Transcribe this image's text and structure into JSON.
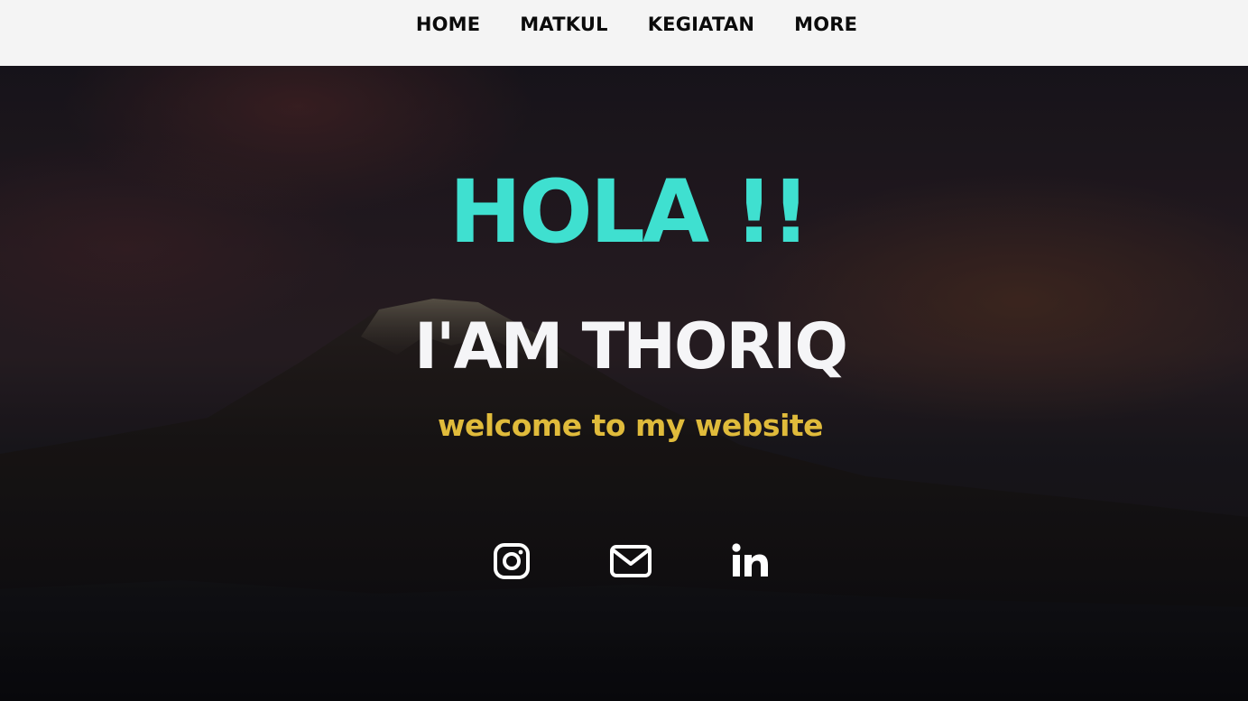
{
  "nav": {
    "items": [
      {
        "label": "HOME"
      },
      {
        "label": "MATKUL"
      },
      {
        "label": "KEGIATAN"
      },
      {
        "label": "MORE"
      }
    ]
  },
  "hero": {
    "greeting": "HOLA !!",
    "name": "I'AM THORIQ",
    "tagline": "welcome to my website",
    "background": "mountain-at-dusk-photo"
  },
  "social": [
    {
      "icon": "instagram-icon"
    },
    {
      "icon": "mail-icon"
    },
    {
      "icon": "linkedin-icon"
    }
  ],
  "colors": {
    "nav_bg": "#f4f4f4",
    "nav_text": "#0b0b0b",
    "greeting": "#3fe0d0",
    "name": "#f5f5f7",
    "tagline": "#e0bb3b",
    "icons": "#ffffff"
  }
}
